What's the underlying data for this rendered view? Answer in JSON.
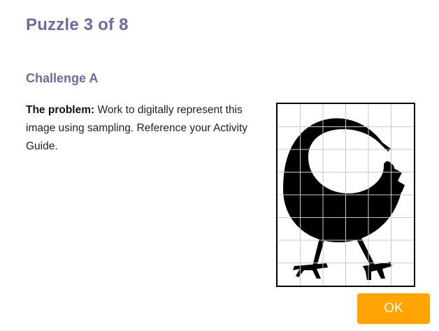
{
  "header": {
    "title": "Puzzle 3 of 8"
  },
  "challenge": {
    "name": "Challenge A",
    "problem_lead": "The problem:",
    "problem_text": " Work to digitally represent this image using sampling. Reference your Activity Guide."
  },
  "image": {
    "icon": "bird-silhouette-on-grid",
    "grid_columns": 6,
    "grid_rows": 8,
    "grid_color": "#c8c8c8",
    "fill_color": "#000000"
  },
  "actions": {
    "ok_label": "OK",
    "ok_color": "#ffa400"
  },
  "colors": {
    "heading": "#7665a0"
  }
}
